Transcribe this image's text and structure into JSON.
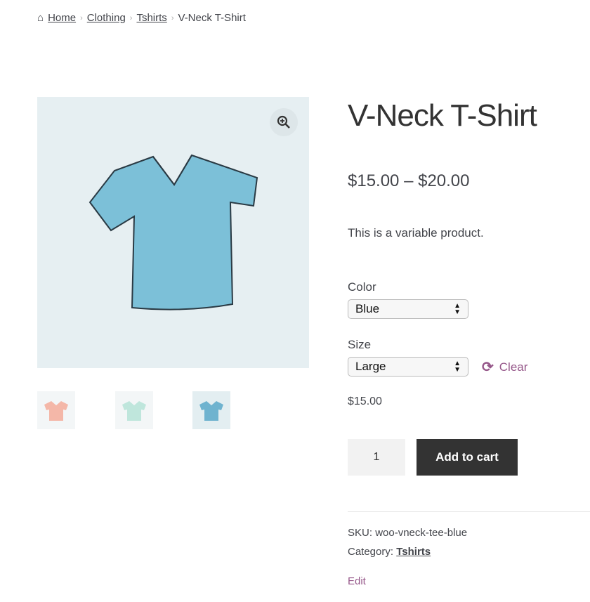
{
  "breadcrumb": {
    "items": [
      "Home",
      "Clothing",
      "Tshirts"
    ],
    "current": "V-Neck T-Shirt"
  },
  "product": {
    "title": "V-Neck T-Shirt",
    "price_range": "$15.00 – $20.00",
    "description": "This is a variable product.",
    "color_label": "Color",
    "color_value": "Blue",
    "size_label": "Size",
    "size_value": "Large",
    "clear_label": "Clear",
    "variation_price": "$15.00",
    "quantity": "1",
    "add_to_cart": "Add to cart",
    "sku_label": "SKU:",
    "sku": "woo-vneck-tee-blue",
    "category_label": "Category:",
    "category": "Tshirts",
    "edit": "Edit"
  },
  "thumbnails": [
    {
      "color": "#f4b7a8"
    },
    {
      "color": "#bfe6dc"
    },
    {
      "color": "#6fb3cf"
    }
  ],
  "colors": {
    "accent": "#96588a",
    "button": "#333333",
    "shirt": "#7cc0d8"
  }
}
